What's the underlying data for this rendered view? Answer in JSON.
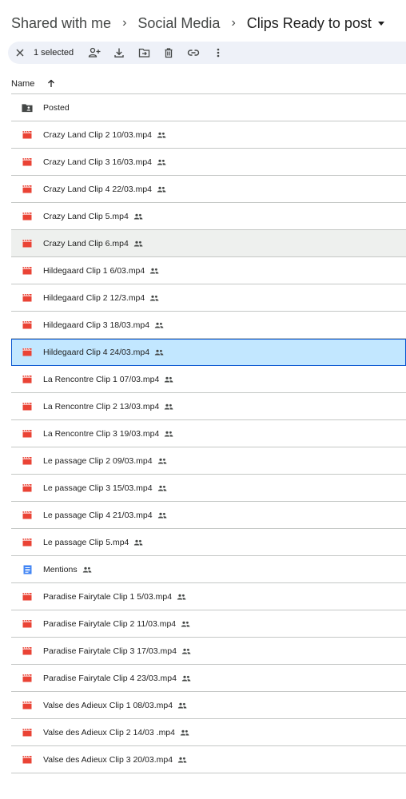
{
  "breadcrumb": {
    "items": [
      "Shared with me",
      "Social Media"
    ],
    "current": "Clips Ready to post"
  },
  "actionbar": {
    "selected_text": "1 selected",
    "icons": [
      "share-person-add-icon",
      "download-icon",
      "move-to-folder-icon",
      "trash-icon",
      "link-icon",
      "more-vert-icon"
    ]
  },
  "table": {
    "header_name": "Name",
    "sort_direction": "ascending"
  },
  "files": [
    {
      "name": "Posted",
      "type": "shared-folder",
      "shared": false
    },
    {
      "name": "Crazy Land Clip 2 10/03.mp4",
      "type": "video",
      "shared": true
    },
    {
      "name": "Crazy Land Clip 3 16/03.mp4",
      "type": "video",
      "shared": true
    },
    {
      "name": "Crazy Land Clip 4 22/03.mp4",
      "type": "video",
      "shared": true
    },
    {
      "name": "Crazy Land Clip 5.mp4",
      "type": "video",
      "shared": true
    },
    {
      "name": "Crazy Land Clip 6.mp4",
      "type": "video",
      "shared": true
    },
    {
      "name": "Hildegaard Clip 1 6/03.mp4",
      "type": "video",
      "shared": true
    },
    {
      "name": "Hildegaard Clip 2 12/3.mp4",
      "type": "video",
      "shared": true
    },
    {
      "name": "Hildegaard Clip 3 18/03.mp4",
      "type": "video",
      "shared": true
    },
    {
      "name": "Hildegaard Clip 4 24/03.mp4",
      "type": "video",
      "shared": true
    },
    {
      "name": "La Rencontre Clip 1 07/03.mp4",
      "type": "video",
      "shared": true
    },
    {
      "name": "La Rencontre Clip 2 13/03.mp4",
      "type": "video",
      "shared": true
    },
    {
      "name": "La Rencontre Clip 3 19/03.mp4",
      "type": "video",
      "shared": true
    },
    {
      "name": "Le passage Clip 2 09/03.mp4",
      "type": "video",
      "shared": true
    },
    {
      "name": "Le passage Clip 3 15/03.mp4",
      "type": "video",
      "shared": true
    },
    {
      "name": "Le passage Clip 4 21/03.mp4",
      "type": "video",
      "shared": true
    },
    {
      "name": "Le passage Clip 5.mp4",
      "type": "video",
      "shared": true
    },
    {
      "name": "Mentions",
      "type": "doc",
      "shared": true
    },
    {
      "name": "Paradise Fairytale Clip 1 5/03.mp4",
      "type": "video",
      "shared": true
    },
    {
      "name": "Paradise Fairytale Clip 2 11/03.mp4",
      "type": "video",
      "shared": true
    },
    {
      "name": "Paradise Fairytale Clip 3 17/03.mp4",
      "type": "video",
      "shared": true
    },
    {
      "name": "Paradise Fairytale Clip 4 23/03.mp4",
      "type": "video",
      "shared": true
    },
    {
      "name": "Valse des Adieux Clip 1 08/03.mp4",
      "type": "video",
      "shared": true
    },
    {
      "name": "Valse des Adieux Clip 2 14/03 .mp4",
      "type": "video",
      "shared": true
    },
    {
      "name": "Valse des Adieux Clip 3 20/03.mp4",
      "type": "video",
      "shared": true
    }
  ],
  "state": {
    "hover_row": "Crazy Land Clip 6.mp4",
    "selected_row": "Hildegaard Clip 4 24/03.mp4"
  },
  "colors": {
    "video_icon": "#ea4335",
    "doc_icon": "#4285f4",
    "selected_bg": "#c2e7ff",
    "selected_border": "#0b57d0",
    "actionbar_bg": "#eef1f8"
  }
}
